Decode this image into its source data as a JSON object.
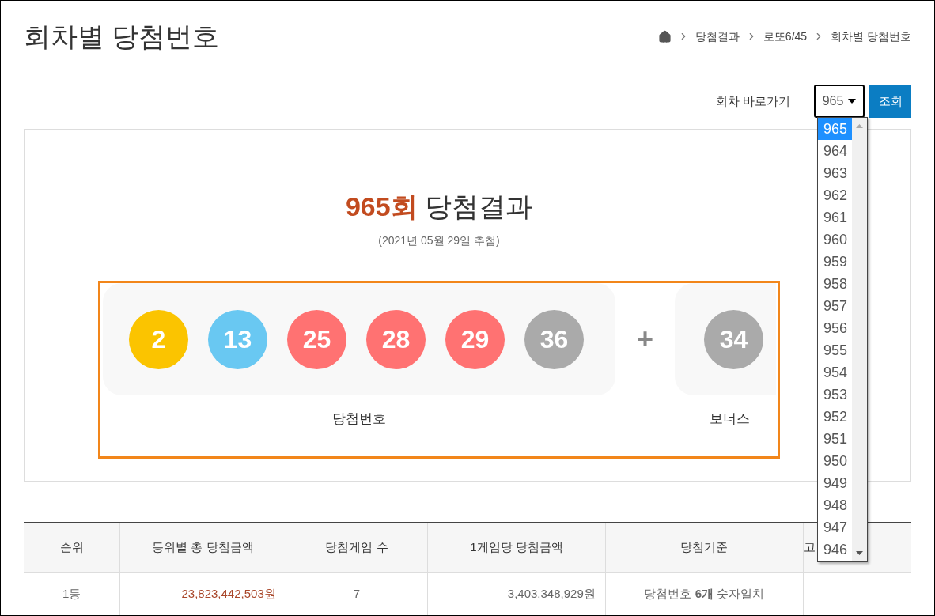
{
  "page_title": "회차별 당첨번호",
  "breadcrumb": [
    "당첨결과",
    "로또6/45",
    "회차별 당첨번호"
  ],
  "round_picker": {
    "label": "회차 바로가기",
    "value": "965",
    "button": "조회"
  },
  "round_options": [
    {
      "label": "965",
      "selected": true
    },
    {
      "label": "964",
      "selected": false
    },
    {
      "label": "963",
      "selected": false
    },
    {
      "label": "962",
      "selected": false
    },
    {
      "label": "961",
      "selected": false
    },
    {
      "label": "960",
      "selected": false
    },
    {
      "label": "959",
      "selected": false
    },
    {
      "label": "958",
      "selected": false
    },
    {
      "label": "957",
      "selected": false
    },
    {
      "label": "956",
      "selected": false
    },
    {
      "label": "955",
      "selected": false
    },
    {
      "label": "954",
      "selected": false
    },
    {
      "label": "953",
      "selected": false
    },
    {
      "label": "952",
      "selected": false
    },
    {
      "label": "951",
      "selected": false
    },
    {
      "label": "950",
      "selected": false
    },
    {
      "label": "949",
      "selected": false
    },
    {
      "label": "948",
      "selected": false
    },
    {
      "label": "947",
      "selected": false
    },
    {
      "label": "946",
      "selected": false
    }
  ],
  "result": {
    "round": "965회",
    "title": "당첨결과",
    "date": "(2021년 05월 29일 추첨)",
    "numbers": [
      {
        "value": "2",
        "color": "#fbc400"
      },
      {
        "value": "13",
        "color": "#69c8f2"
      },
      {
        "value": "25",
        "color": "#ff7272"
      },
      {
        "value": "28",
        "color": "#ff7272"
      },
      {
        "value": "29",
        "color": "#ff7272"
      },
      {
        "value": "36",
        "color": "#aaaaaa"
      }
    ],
    "plus": "+",
    "bonus": {
      "value": "34",
      "color": "#aaaaaa"
    },
    "numbers_label": "당첨번호",
    "bonus_label": "보너스"
  },
  "table": {
    "columns": [
      "순위",
      "등위별 총 당첨금액",
      "당첨게임 수",
      "1게임당 당첨금액",
      "당첨기준",
      "고"
    ],
    "rows": [
      [
        "1등",
        "23,823,442,503원",
        "7",
        "3,403,348,929원",
        "당첨번호 **6개** 숫자일치",
        ""
      ]
    ]
  }
}
